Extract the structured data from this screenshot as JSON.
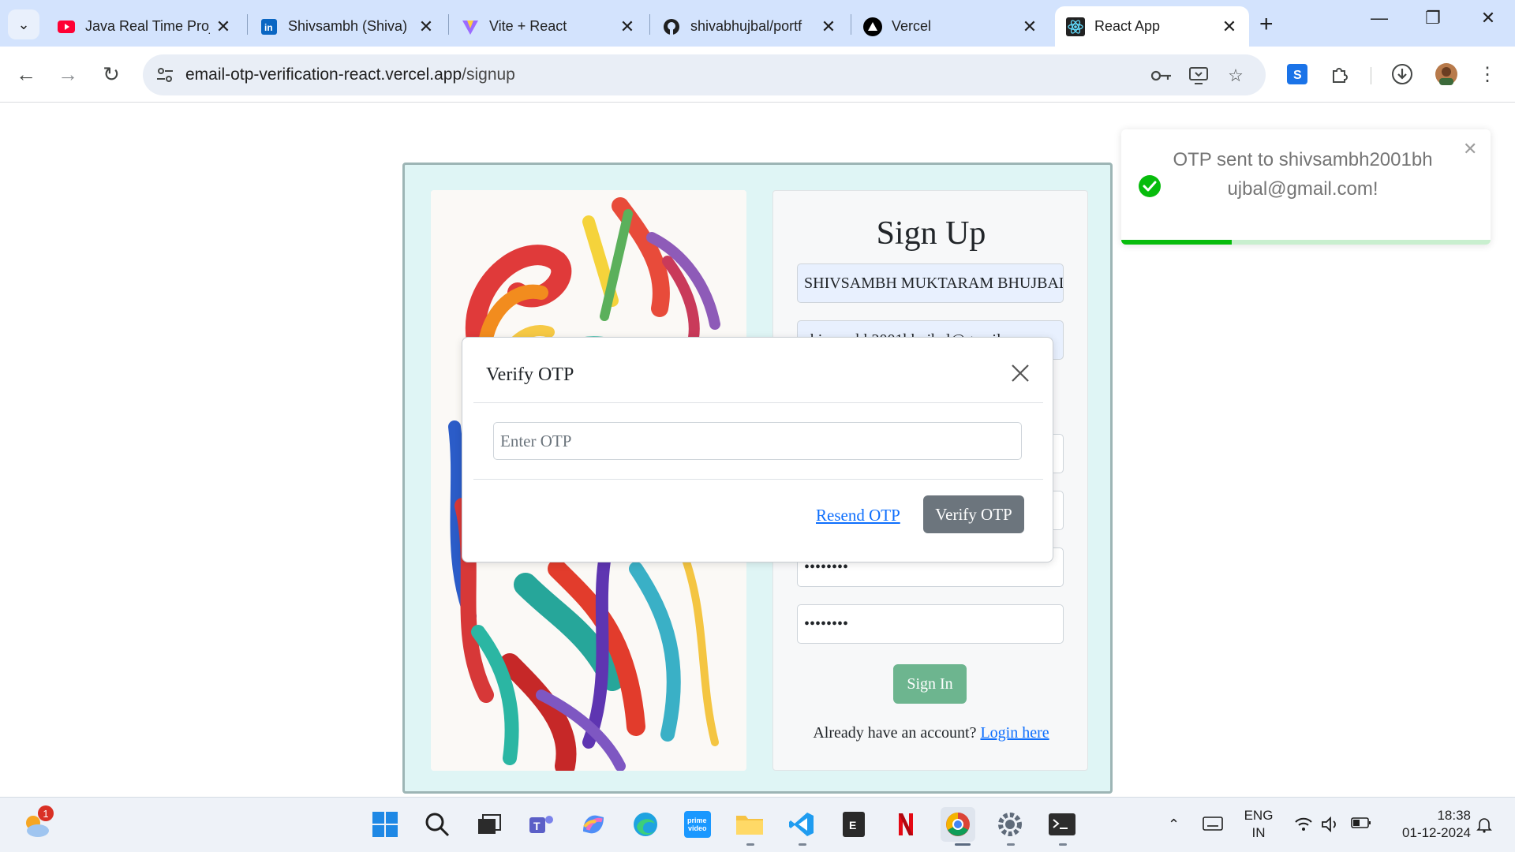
{
  "browser": {
    "tabs": [
      {
        "title": "Java Real Time Proj",
        "icon": "youtube-icon"
      },
      {
        "title": "Shivsambh (Shiva)",
        "icon": "linkedin-icon"
      },
      {
        "title": "Vite + React",
        "icon": "vite-icon"
      },
      {
        "title": "shivabhujbal/portf",
        "icon": "github-icon"
      },
      {
        "title": "Vercel",
        "icon": "vercel-icon"
      },
      {
        "title": "React App",
        "icon": "react-icon",
        "active": true
      }
    ],
    "url_host": "email-otp-verification-react.vercel.app",
    "url_path": "/signup"
  },
  "signup": {
    "title": "Sign Up",
    "name_value": "SHIVSAMBH MUKTARAM BHUJBAL",
    "email_value": "shivsambh2001bhujbal@gmail.com",
    "password_value": "••••••••",
    "confirm_password_value": "••••••••",
    "signin_label": "Sign In",
    "login_prompt": "Already have an account?",
    "login_link": "Login here"
  },
  "modal": {
    "title": "Verify OTP",
    "otp_placeholder": "Enter OTP",
    "resend_label": "Resend OTP",
    "verify_label": "Verify OTP"
  },
  "toast": {
    "message": "OTP sent to shivsambh2001bhujbal@gmail.com!",
    "progress": 0.3
  },
  "taskbar": {
    "weather_badge": "1",
    "language_line1": "ENG",
    "language_line2": "IN",
    "time": "18:38",
    "date": "01-12-2024"
  },
  "colors": {
    "card_bg": "#dff5f5",
    "signin_button": "#6db58f",
    "verify_button": "#6c757d",
    "link": "#0d6efd",
    "toast_success": "#07bc0c"
  }
}
